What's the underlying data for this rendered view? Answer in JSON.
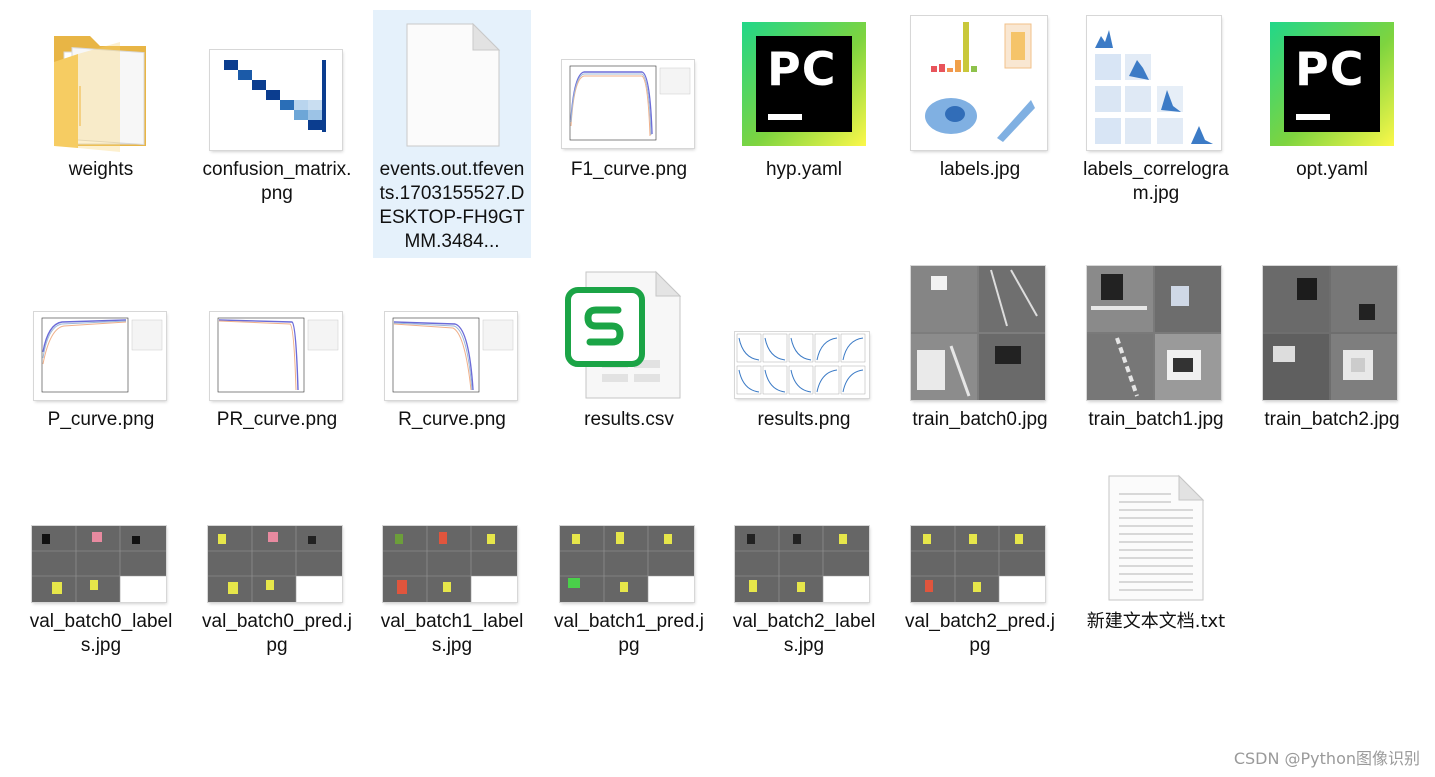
{
  "files": [
    {
      "name": "weights",
      "type": "folder"
    },
    {
      "name": "confusion_matrix.png",
      "type": "image"
    },
    {
      "name": "events.out.tfevents.1703155527.DESKTOP-FH9GTMM.3484...",
      "type": "generic",
      "selected": true
    },
    {
      "name": "F1_curve.png",
      "type": "image"
    },
    {
      "name": "hyp.yaml",
      "type": "pycharm"
    },
    {
      "name": "labels.jpg",
      "type": "image"
    },
    {
      "name": "labels_correlogram.jpg",
      "type": "image"
    },
    {
      "name": "opt.yaml",
      "type": "pycharm"
    },
    {
      "name": "P_curve.png",
      "type": "image"
    },
    {
      "name": "PR_curve.png",
      "type": "image"
    },
    {
      "name": "R_curve.png",
      "type": "image"
    },
    {
      "name": "results.csv",
      "type": "spreadsheet"
    },
    {
      "name": "results.png",
      "type": "image"
    },
    {
      "name": "train_batch0.jpg",
      "type": "image"
    },
    {
      "name": "train_batch1.jpg",
      "type": "image"
    },
    {
      "name": "train_batch2.jpg",
      "type": "image"
    },
    {
      "name": "val_batch0_labels.jpg",
      "type": "image"
    },
    {
      "name": "val_batch0_pred.jpg",
      "type": "image"
    },
    {
      "name": "val_batch1_labels.jpg",
      "type": "image"
    },
    {
      "name": "val_batch1_pred.jpg",
      "type": "image"
    },
    {
      "name": "val_batch2_labels.jpg",
      "type": "image"
    },
    {
      "name": "val_batch2_pred.jpg",
      "type": "image"
    },
    {
      "name": "新建文本文档.txt",
      "type": "text"
    }
  ],
  "pycharm_icon_text": "PC",
  "watermark": "CSDN @Python图像识别",
  "colors": {
    "selection": "#e5f1fb",
    "folder": "#f5c95b",
    "pycharm_green": "#21d789",
    "pycharm_yellow": "#fcf84a",
    "csv_green": "#1ba446",
    "matrix_blue": "#0b3d8f"
  }
}
